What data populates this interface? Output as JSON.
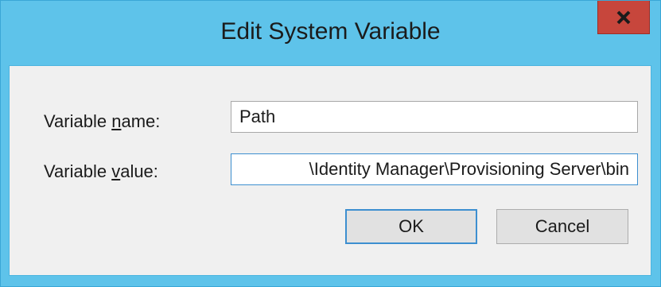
{
  "dialog": {
    "title": "Edit System Variable",
    "close_icon": "close-icon"
  },
  "form": {
    "name_label_prefix": "Variable ",
    "name_label_accel": "n",
    "name_label_suffix": "ame:",
    "name_value": "Path",
    "value_label_prefix": "Variable ",
    "value_label_accel": "v",
    "value_label_suffix": "alue:",
    "value_value": "\\Identity Manager\\Provisioning Server\\bin"
  },
  "buttons": {
    "ok_label": "OK",
    "cancel_label": "Cancel"
  },
  "colors": {
    "titlebar": "#5ec3ea",
    "close_button": "#c7463c",
    "client": "#f0f0f0",
    "focus_border": "#3d8fd0"
  }
}
